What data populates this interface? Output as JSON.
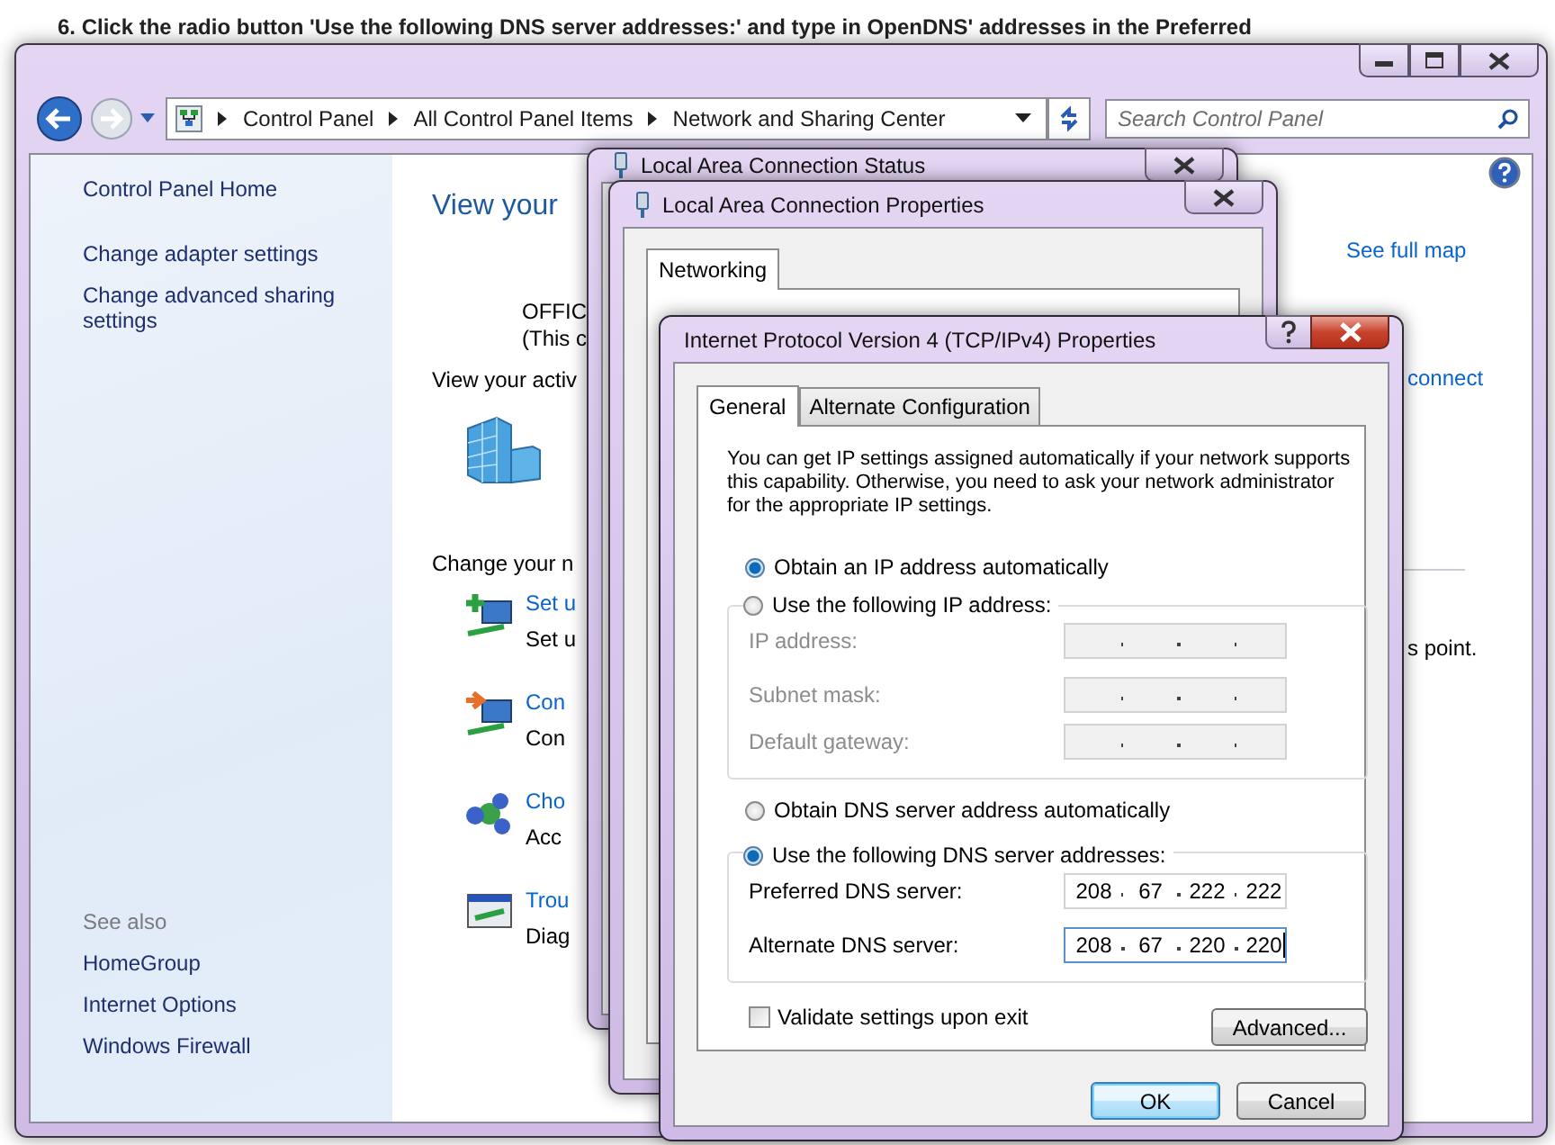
{
  "instruction": "6. Click the radio button 'Use the following DNS server addresses:' and type in OpenDNS' addresses in the Preferred",
  "explorer": {
    "breadcrumb": [
      "Control Panel",
      "All Control Panel Items",
      "Network and Sharing Center"
    ],
    "search": {
      "placeholder": "Search Control Panel"
    },
    "sidebar": {
      "links": [
        "Control Panel Home",
        "Change adapter settings",
        "Change advanced sharing settings"
      ],
      "see_also_heading": "See also",
      "see_also": [
        "HomeGroup",
        "Internet Options",
        "Windows Firewall"
      ]
    },
    "content": {
      "title": "View your",
      "computer_name": "OFFIC",
      "computer_note": "(This c",
      "active_heading": "View your activ",
      "change_heading": "Change your n",
      "tasks": [
        {
          "kind": "setup",
          "link": "Set u",
          "description": "Set u"
        },
        {
          "kind": "connect",
          "link": "Con",
          "description": "Con"
        },
        {
          "kind": "homegroup",
          "link": "Cho",
          "description": "Acc"
        },
        {
          "kind": "troubleshoot",
          "link": "Trou",
          "description": "Diag"
        }
      ],
      "see_full_map": "See full map",
      "connect_link": "connect",
      "access_point_text": "s point."
    }
  },
  "status_window": {
    "title": "Local Area Connection Status"
  },
  "properties_window": {
    "title": "Local Area Connection Properties",
    "tabs": [
      {
        "label": "Networking",
        "selected": true
      }
    ]
  },
  "ipv4_dialog": {
    "title": "Internet Protocol Version 4 (TCP/IPv4) Properties",
    "tabs": [
      {
        "label": "General",
        "selected": true
      },
      {
        "label": "Alternate Configuration",
        "selected": false
      }
    ],
    "description": "You can get IP settings assigned automatically if your network supports this capability. Otherwise, you need to ask your network administrator for the appropriate IP settings.",
    "ip_options": [
      {
        "label": "Obtain an IP address automatically",
        "selected": true
      },
      {
        "label": "Use the following IP address:",
        "selected": false
      }
    ],
    "ip_fields": [
      {
        "label": "IP address:",
        "disabled": true,
        "focused": false
      },
      {
        "label": "Subnet mask:",
        "disabled": true,
        "focused": false
      },
      {
        "label": "Default gateway:",
        "disabled": true,
        "focused": false
      }
    ],
    "dns_options": [
      {
        "label": "Obtain DNS server address automatically",
        "selected": false
      },
      {
        "label": "Use the following DNS server addresses:",
        "selected": true
      }
    ],
    "dns_fields": [
      {
        "label": "Preferred DNS server:",
        "disabled": false,
        "focused": false,
        "octets": [
          "208",
          "67",
          "222",
          "222"
        ]
      },
      {
        "label": "Alternate DNS server:",
        "disabled": false,
        "focused": true,
        "octets": [
          "208",
          "67",
          "220",
          "220"
        ]
      }
    ],
    "validate": {
      "label": "Validate settings upon exit",
      "checked": false
    },
    "advanced_button": "Advanced...",
    "buttons": [
      {
        "label": "OK",
        "default": true
      },
      {
        "label": "Cancel",
        "default": false
      }
    ]
  }
}
